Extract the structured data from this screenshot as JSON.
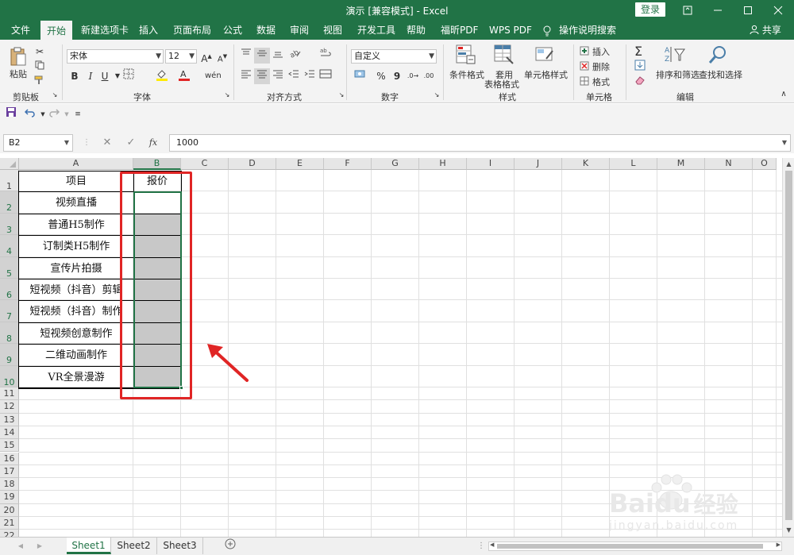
{
  "titlebar": {
    "title": "演示 [兼容模式] - Excel",
    "login_label": "登录"
  },
  "menu": {
    "tabs": [
      "文件",
      "开始",
      "新建选项卡",
      "插入",
      "页面布局",
      "公式",
      "数据",
      "审阅",
      "视图",
      "开发工具",
      "帮助",
      "福昕PDF",
      "WPS PDF",
      "操作说明搜索"
    ],
    "share_label": "共享"
  },
  "ribbon": {
    "clipboard": {
      "paste_label": "粘贴",
      "group_label": "剪贴板"
    },
    "font": {
      "font_name": "宋体",
      "font_size": "12",
      "bold": "B",
      "italic": "I",
      "underline": "U",
      "group_label": "字体"
    },
    "alignment": {
      "group_label": "对齐方式"
    },
    "number": {
      "format_value": "自定义",
      "percent": "%",
      "comma": "9",
      "group_label": "数字"
    },
    "styles": {
      "conditional_label": "条件格式",
      "table_label_1": "套用",
      "table_label_2": "表格格式",
      "cell_style_label": "单元格样式",
      "group_label": "样式"
    },
    "cells": {
      "insert_label": "插入",
      "delete_label": "删除",
      "format_label": "格式",
      "group_label": "单元格"
    },
    "editing": {
      "sort_label": "排序和筛选",
      "find_label": "查找和选择",
      "group_label": "编辑"
    }
  },
  "formula_bar": {
    "name_box": "B2",
    "fx_label": "fx",
    "formula_value": "1000"
  },
  "sheet": {
    "columns": [
      "A",
      "B",
      "C",
      "D",
      "E",
      "F",
      "G",
      "H",
      "I",
      "J",
      "K",
      "L",
      "M",
      "N",
      "O"
    ],
    "rows": [
      "1",
      "2",
      "3",
      "4",
      "5",
      "6",
      "7",
      "8",
      "9",
      "10",
      "11",
      "12",
      "13",
      "14",
      "15",
      "16",
      "17",
      "18",
      "19",
      "20",
      "21",
      "22"
    ],
    "header_a": "项目",
    "header_b": "报价",
    "items": [
      "视频直播",
      "普通H5制作",
      "订制类H5制作",
      "宣传片拍摄",
      "短视频（抖音）剪辑",
      "短视频（抖音）制作",
      "短视频创意制作",
      "二维动画制作",
      "VR全景漫游"
    ]
  },
  "sheet_tabs": [
    "Sheet1",
    "Sheet2",
    "Sheet3"
  ],
  "colors": {
    "accent": "#217346",
    "annotation_red": "#e02525",
    "fill_gray": "#c8c8c8"
  },
  "watermark": {
    "text_brand": "Bai",
    "text_du": "du",
    "text_cn": "经验",
    "url": "jingyan.baidu.com"
  }
}
